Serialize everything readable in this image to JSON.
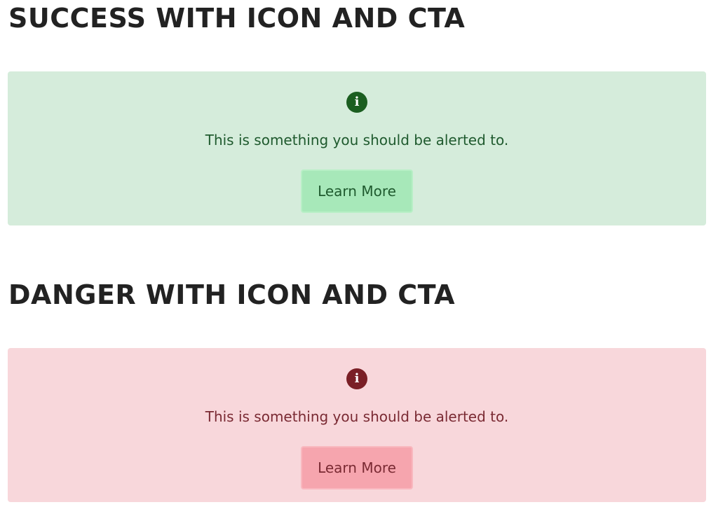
{
  "sections": [
    {
      "title": "SUCCESS WITH ICON AND CTA",
      "variant": "success",
      "icon": "info-icon",
      "icon_glyph": "i",
      "message": "This is something you should be alerted to.",
      "button_label": "Learn More",
      "colors": {
        "background": "#d5ecdb",
        "icon": "#1b5e20",
        "text": "#1f5a2e",
        "button": "#a7e8b9"
      }
    },
    {
      "title": "DANGER WITH ICON AND CTA",
      "variant": "danger",
      "icon": "info-icon",
      "icon_glyph": "i",
      "message": "This is something you should be alerted to.",
      "button_label": "Learn More",
      "colors": {
        "background": "#f8d7db",
        "icon": "#7a1f26",
        "text": "#7a2a33",
        "button": "#f6a5ae"
      }
    }
  ]
}
